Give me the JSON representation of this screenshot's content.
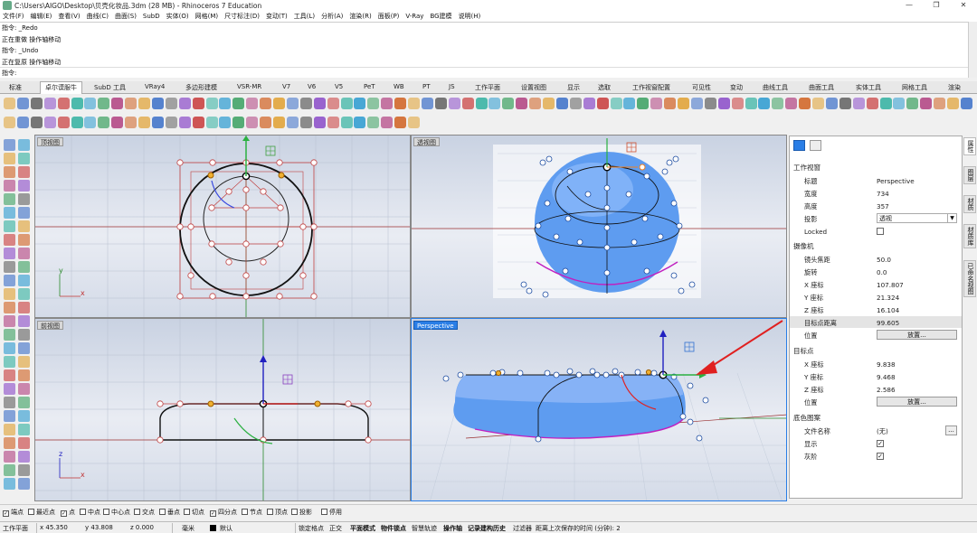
{
  "title": "C:\\Users\\AIGO\\Desktop\\贝壳化妆品.3dm (28 MB) - Rhinoceros 7 Education",
  "window_buttons": [
    "—",
    "❐",
    "✕"
  ],
  "menu": [
    "文件(F)",
    "编辑(E)",
    "查看(V)",
    "曲线(C)",
    "曲面(S)",
    "SubD",
    "实体(O)",
    "网格(M)",
    "尺寸标注(D)",
    "变动(T)",
    "工具(L)",
    "分析(A)",
    "渲染(R)",
    "面板(P)",
    "V-Ray",
    "BG建模",
    "说明(H)"
  ],
  "history": [
    "指令: _Redo",
    "正在重做 操作轴移动",
    "指令: _Undo",
    "正在复原 操作轴移动"
  ],
  "command_prompt": "指令:",
  "tabs": [
    "标准",
    "卓尔谟服牛",
    "SubD 工具",
    "VRay4",
    "多边形建模",
    "VSR-MR",
    "V7",
    "V6",
    "V5",
    "PeT",
    "WB",
    "PT",
    "JS",
    "工作平面",
    "设置视图",
    "显示",
    "选取",
    "工作视窗配置",
    "可见性",
    "变动",
    "曲线工具",
    "曲面工具",
    "实体工具",
    "网格工具",
    "渲染"
  ],
  "active_tab": 1,
  "viewports": {
    "top": "顶视图",
    "persp_top": "透视图",
    "front": "前视图",
    "perspective": "Perspective"
  },
  "panel": {
    "section_viewport": "工作视窗",
    "props": [
      {
        "label": "标题",
        "value": "Perspective"
      },
      {
        "label": "宽度",
        "value": "734"
      },
      {
        "label": "高度",
        "value": "357"
      },
      {
        "label": "投影",
        "value": "透视"
      },
      {
        "label": "Locked",
        "value": ""
      }
    ],
    "section_camera": "摄像机",
    "camera": [
      {
        "label": "镜头焦距",
        "value": "50.0"
      },
      {
        "label": "旋转",
        "value": "0.0"
      },
      {
        "label": "X 座标",
        "value": "107.807"
      },
      {
        "label": "Y 座标",
        "value": "21.324"
      },
      {
        "label": "Z 座标",
        "value": "16.104"
      },
      {
        "label": "目标点距离",
        "value": "99.605"
      },
      {
        "label": "位置",
        "value": "放置..."
      }
    ],
    "section_target": "目标点",
    "target": [
      {
        "label": "X 座标",
        "value": "9.838"
      },
      {
        "label": "Y 座标",
        "value": "9.468"
      },
      {
        "label": "Z 座标",
        "value": "2.586"
      },
      {
        "label": "位置",
        "value": "放置..."
      }
    ],
    "section_wallpaper": "底色图案",
    "wallpaper": [
      {
        "label": "文件名称",
        "value": "(无)"
      },
      {
        "label": "显示",
        "value": "✓"
      },
      {
        "label": "灰阶",
        "value": "✓"
      }
    ],
    "more_button": "..."
  },
  "right_tabs": [
    "属性",
    "图层",
    "材质",
    "材质库",
    "已命名视图"
  ],
  "osnaps": [
    {
      "label": "端点",
      "checked": true
    },
    {
      "label": "最近点",
      "checked": false
    },
    {
      "label": "点",
      "checked": true
    },
    {
      "label": "中点",
      "checked": false
    },
    {
      "label": "中心点",
      "checked": false
    },
    {
      "label": "交点",
      "checked": false
    },
    {
      "label": "垂点",
      "checked": false
    },
    {
      "label": "切点",
      "checked": false
    },
    {
      "label": "四分点",
      "checked": true
    },
    {
      "label": "节点",
      "checked": false
    },
    {
      "label": "顶点",
      "checked": false
    },
    {
      "label": "投影",
      "checked": false
    },
    {
      "label": "停用",
      "checked": false
    }
  ],
  "status": {
    "plane": "工作平面",
    "x": "x 45.350",
    "y": "y 43.808",
    "z": "z 0.000",
    "unit": "毫米",
    "layer": "默认",
    "items": [
      "锁定格点",
      "正交",
      "平面模式",
      "物件锁点",
      "智慧轨迹",
      "操作轴",
      "记录建构历史",
      "过滤器"
    ],
    "bold_items": [
      2,
      3,
      5,
      6
    ],
    "save_msg": "距离上次保存的时间 (分钟): 2"
  },
  "colors": {
    "accent": "#2a7ee6",
    "shell": "#5e9cf0",
    "arrow": "#e02020"
  }
}
